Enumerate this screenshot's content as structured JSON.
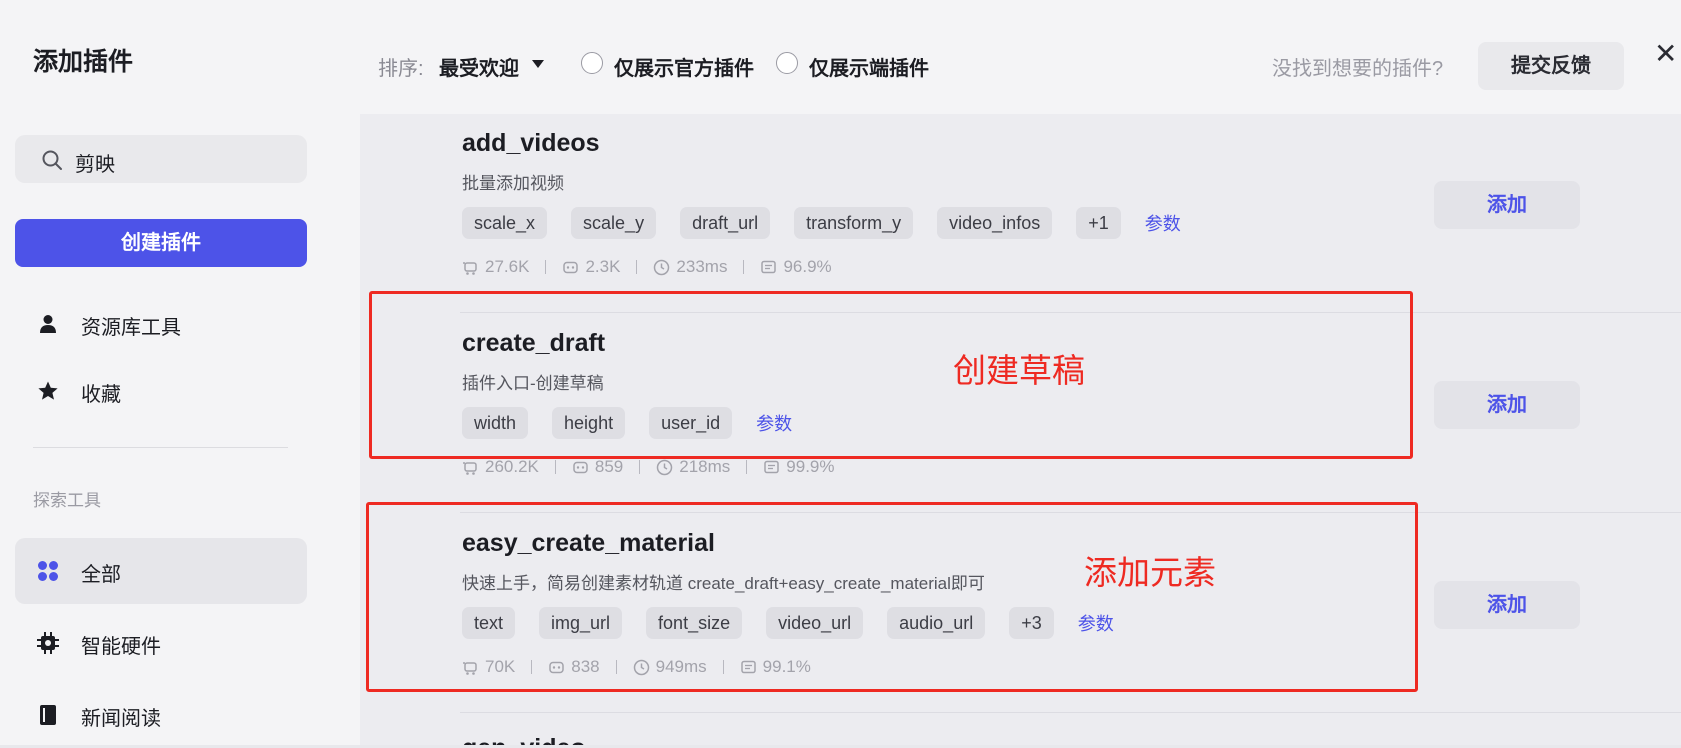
{
  "sidebar": {
    "title": "添加插件",
    "search_value": "剪映",
    "create_button": "创建插件",
    "nav_resource": "资源库工具",
    "nav_favorites": "收藏",
    "section_label": "探索工具",
    "nav_all": "全部",
    "nav_hardware": "智能硬件",
    "nav_news": "新闻阅读"
  },
  "toolbar": {
    "sort_label": "排序:",
    "sort_value": "最受欢迎",
    "filter_official": "仅展示官方插件",
    "filter_client": "仅展示端插件",
    "hint": "没找到想要的插件?",
    "feedback_button": "提交反馈",
    "close": "✕"
  },
  "plugins": [
    {
      "name": "add_videos",
      "desc": "批量添加视频",
      "tags": [
        "scale_x",
        "scale_y",
        "draft_url",
        "transform_y",
        "video_infos",
        "+1"
      ],
      "params": "参数",
      "calls": "27.6K",
      "bots": "2.3K",
      "latency": "233ms",
      "success": "96.9%",
      "add": "添加"
    },
    {
      "name": "create_draft",
      "desc": "插件入口-创建草稿",
      "tags": [
        "width",
        "height",
        "user_id"
      ],
      "params": "参数",
      "calls": "260.2K",
      "bots": "859",
      "latency": "218ms",
      "success": "99.9%",
      "add": "添加"
    },
    {
      "name": "easy_create_material",
      "desc": "快速上手，简易创建素材轨道 create_draft+easy_create_material即可",
      "tags": [
        "text",
        "img_url",
        "font_size",
        "video_url",
        "audio_url",
        "+3"
      ],
      "params": "参数",
      "calls": "70K",
      "bots": "838",
      "latency": "949ms",
      "success": "99.1%",
      "add": "添加"
    }
  ],
  "peek_name": "gen_video",
  "annotations": {
    "create_draft_note": "创建草稿",
    "easy_material_note": "添加元素",
    "color": "#ee2a22"
  },
  "colors": {
    "accent": "#4d53e8"
  }
}
